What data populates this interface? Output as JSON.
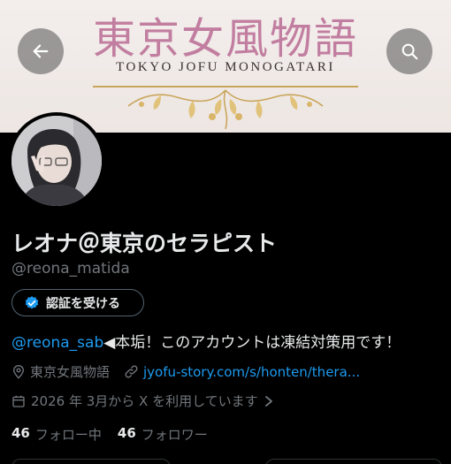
{
  "banner": {
    "title": "東京女風物語",
    "subtitle": "TOKYO JOFU MONOGATARI"
  },
  "header": {
    "back_icon": "arrow-left-icon",
    "search_icon": "search-icon"
  },
  "profile": {
    "display_name": "レオナ＠東京のセラピスト",
    "handle": "@reona_matida",
    "verify_button_label": "認証を受ける",
    "bio_mention": "@reona_sab",
    "bio_text": "◀本垢！このアカウントは凍結対策用です！",
    "location": "東京女風物語",
    "link": "jyofu-story.com/s/honten/thera...",
    "joined": "2026 年 3月から X を利用しています",
    "following_count": "46",
    "following_label": "フォロー中",
    "followers_count": "46",
    "followers_label": "フォロワー"
  },
  "colors": {
    "accent": "#1d9bf0",
    "background": "#000000",
    "muted_text": "#71767b",
    "banner_title": "#c27ea0"
  }
}
